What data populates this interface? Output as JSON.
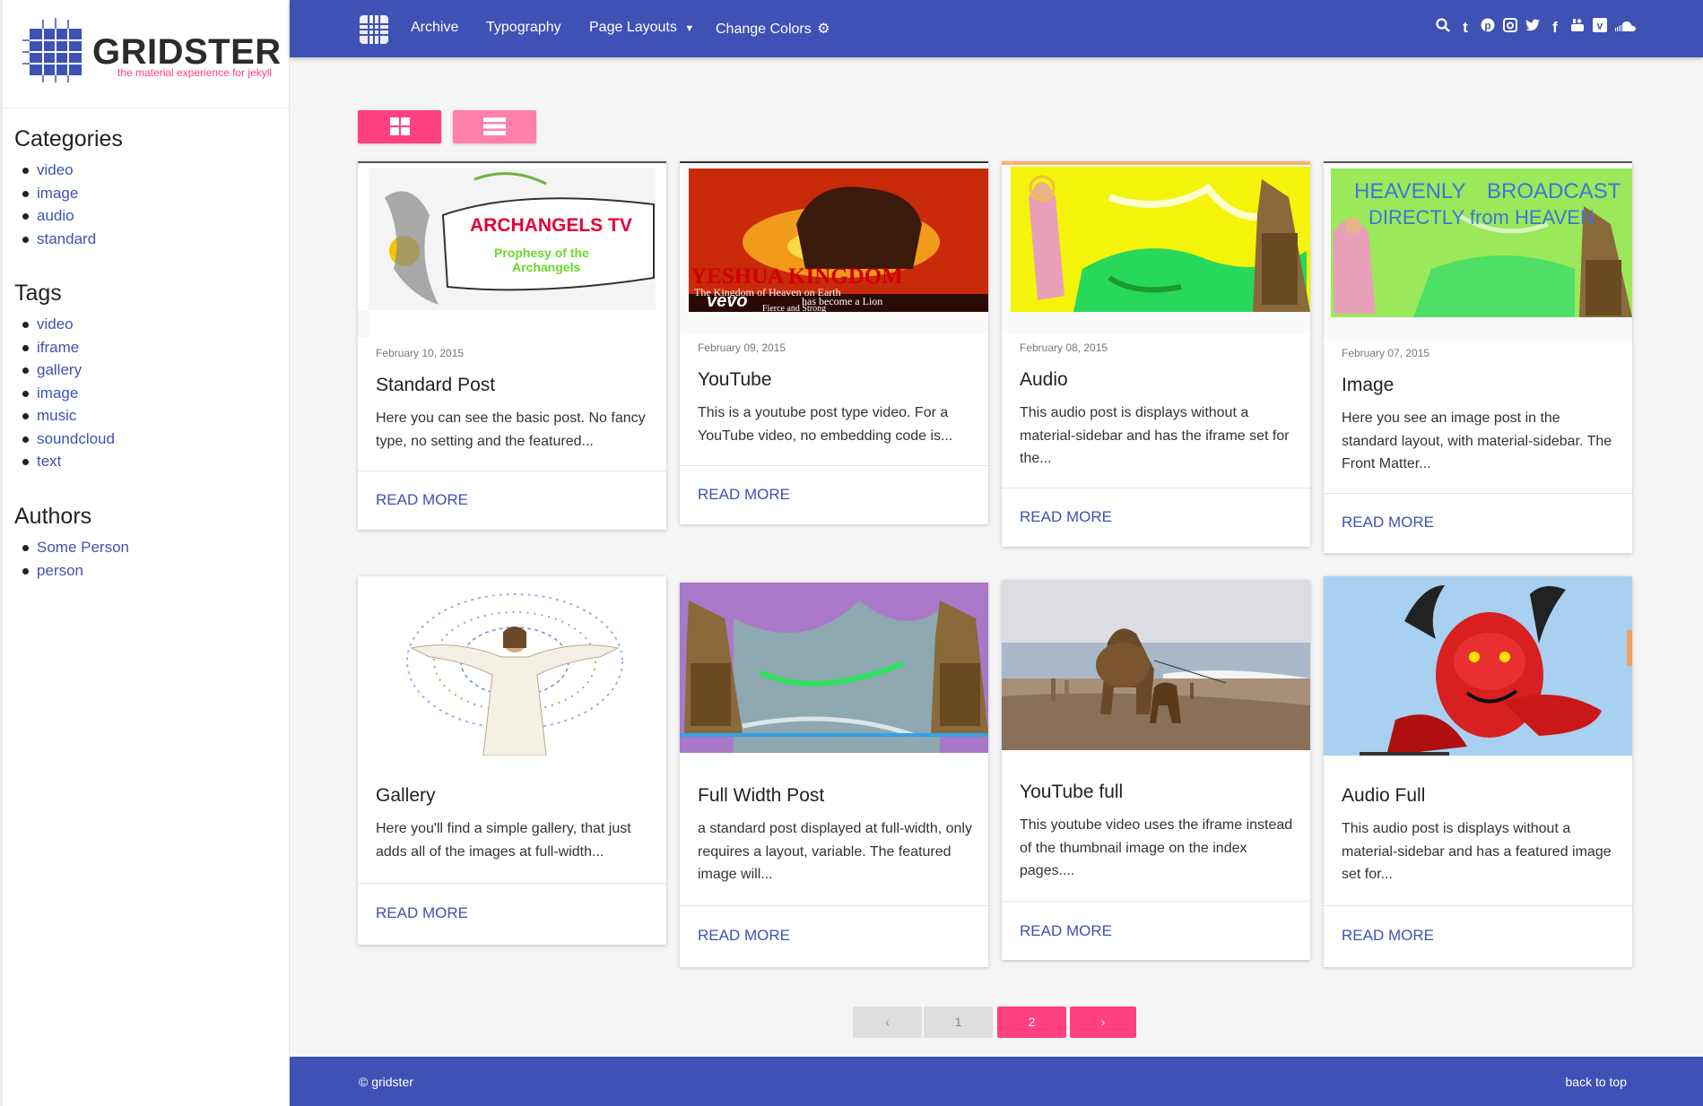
{
  "brand": {
    "name": "GRIDSTER",
    "tagline": "the material experience for jekyll"
  },
  "nav": {
    "items": [
      "Archive",
      "Typography",
      "Page Layouts",
      "Change Colors"
    ],
    "icons": [
      "search-icon",
      "tumblr-icon",
      "pinterest-icon",
      "instagram-icon",
      "twitter-icon",
      "facebook-icon",
      "youtube-icon",
      "vimeo-icon",
      "soundcloud-icon"
    ]
  },
  "sidebar": {
    "categories_title": "Categories",
    "categories": [
      "video",
      "image",
      "audio",
      "standard"
    ],
    "tags_title": "Tags",
    "tags": [
      "video",
      "iframe",
      "gallery",
      "image",
      "music",
      "soundcloud",
      "text"
    ],
    "authors_title": "Authors",
    "authors": [
      "Some Person",
      "person"
    ]
  },
  "cards": [
    {
      "date": "February 10, 2015",
      "title": "Standard Post",
      "excerpt": "Here you can see the basic post. No fancy type, no setting and the featured...",
      "more": "READ MORE",
      "img_text": [
        "ARCHANGELS TV",
        "Prophesy of the",
        "Archangels"
      ]
    },
    {
      "date": "February 09, 2015",
      "title": "YouTube",
      "excerpt": "This is a youtube post type video. For a YouTube video, no embedding code is...",
      "more": "READ MORE",
      "img_text": [
        "YESHUA KINGDOM",
        "The Kingdom of Heaven on Earth",
        "vevo",
        "has become a Lion",
        "Fierce and Strong"
      ]
    },
    {
      "date": "February 08, 2015",
      "title": "Audio",
      "excerpt": "This audio post is displays without a material-sidebar and has the iframe set for the...",
      "more": "READ MORE"
    },
    {
      "date": "February 07, 2015",
      "title": "Image",
      "excerpt": "Here you see an image post in the standard layout, with material-sidebar. The Front Matter...",
      "more": "READ MORE",
      "img_text": [
        "HEAVENLY",
        "BROADCAST",
        "DIRECTLY from HEAVEN"
      ]
    },
    {
      "title": "Gallery",
      "excerpt": "Here you'll find a simple gallery, that just adds all of the images at full-width...",
      "more": "READ MORE"
    },
    {
      "title": "Full Width Post",
      "excerpt": "a standard post displayed at full-width, only requires a layout, variable. The featured image will...",
      "more": "READ MORE"
    },
    {
      "title": "YouTube full",
      "excerpt": "This youtube video uses the iframe instead of the thumbnail image on the index pages....",
      "more": "READ MORE"
    },
    {
      "title": "Audio Full",
      "excerpt": "This audio post is displays without a material-sidebar and has a featured image set for...",
      "more": "READ MORE"
    }
  ],
  "pagination": {
    "prev": "‹",
    "pages": [
      "1",
      "2"
    ],
    "current": "2",
    "next": "›"
  },
  "footer": {
    "copyright": "© gridster",
    "back_to_top": "back to top"
  },
  "colors": {
    "primary": "#3f51b5",
    "accent": "#ff4081",
    "accent_light": "#ff80ab"
  }
}
